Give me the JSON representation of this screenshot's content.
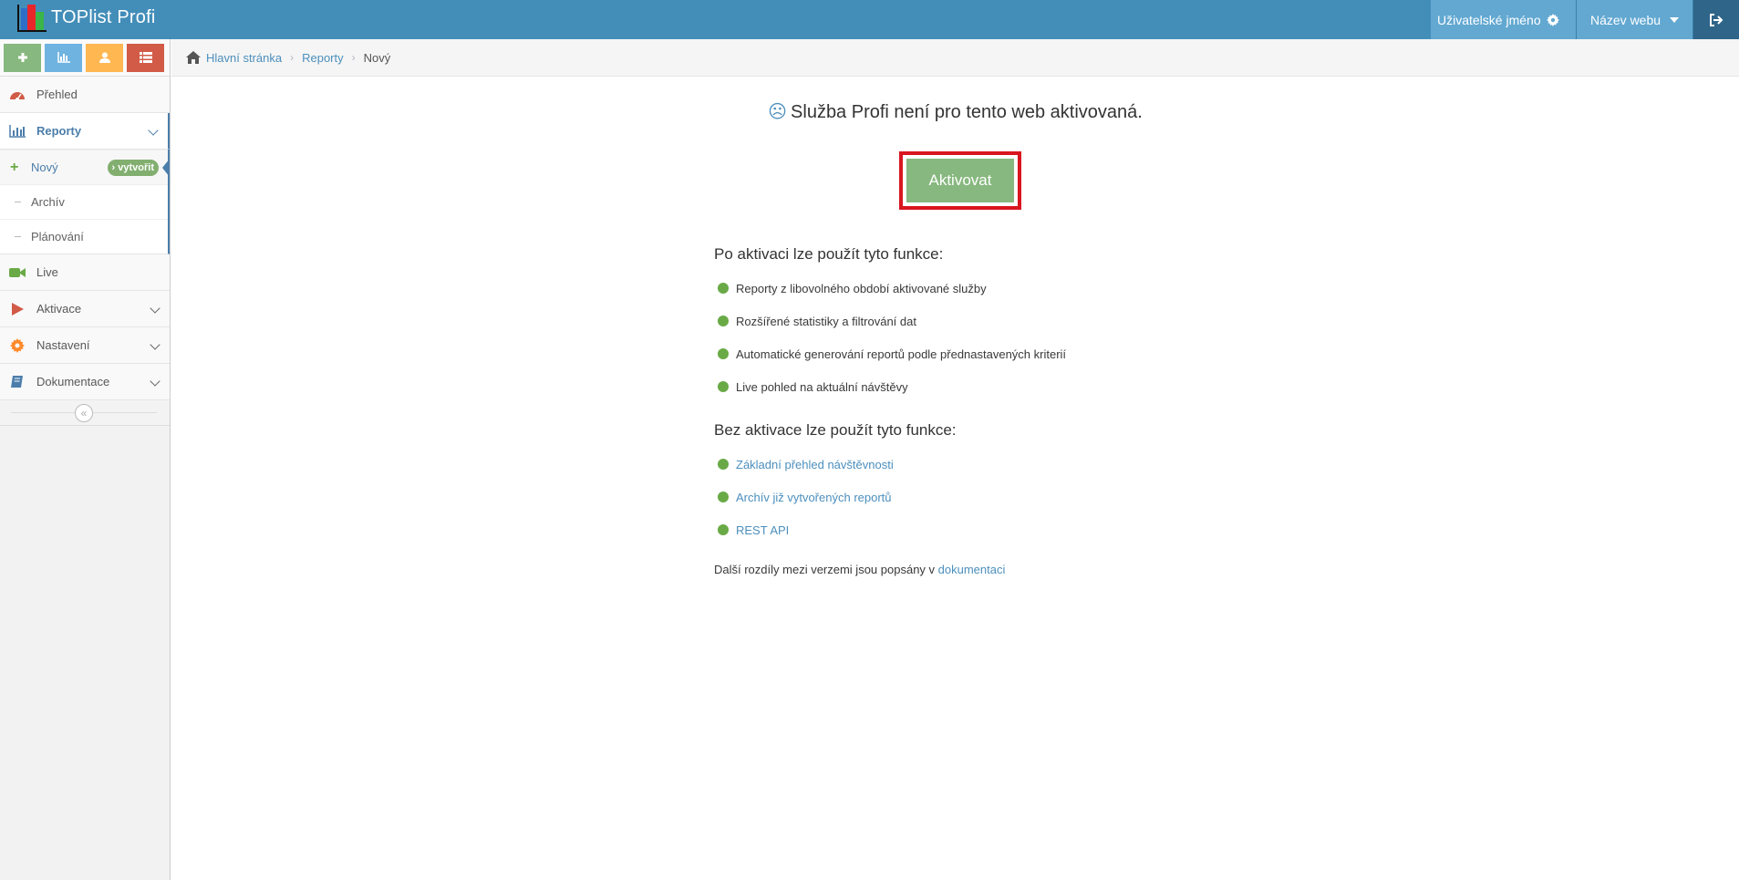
{
  "app": {
    "brand": "TOPlist Profi",
    "user_label": "Uživatelské jméno",
    "site_label": "Název webu"
  },
  "colors": {
    "navbar": "#438eb9",
    "accent_green": "#87b87f",
    "link": "#4c8fbd",
    "highlight_border": "#d9161f"
  },
  "shortcuts": [
    {
      "icon": "plus-icon",
      "color": "#87b87f"
    },
    {
      "icon": "bar-chart-icon",
      "color": "#6fb3e0"
    },
    {
      "icon": "user-icon",
      "color": "#ffb752"
    },
    {
      "icon": "list-icon",
      "color": "#d15b47"
    }
  ],
  "sidebar": {
    "items": [
      {
        "label": "Přehled",
        "icon": "dashboard-icon"
      },
      {
        "label": "Reporty",
        "icon": "bar-chart-icon",
        "open": true
      },
      {
        "label": "Live",
        "icon": "video-camera-icon"
      },
      {
        "label": "Aktivace",
        "icon": "play-icon"
      },
      {
        "label": "Nastavení",
        "icon": "gear-icon"
      },
      {
        "label": "Dokumentace",
        "icon": "book-icon"
      }
    ],
    "submenu": [
      {
        "label": "Nový",
        "badge": "› vytvořit",
        "active": true
      },
      {
        "label": "Archív"
      },
      {
        "label": "Plánování"
      }
    ],
    "collapse_icon": "«"
  },
  "breadcrumb": {
    "home": "Hlavní stránka",
    "reports": "Reporty",
    "current": "Nový"
  },
  "main": {
    "sad_icon": "☹",
    "headline": "Služba Profi není pro tento web aktivovaná.",
    "activate_label": "Aktivovat",
    "with_activation_heading": "Po aktivaci lze použít tyto funkce:",
    "with_activation": [
      "Reporty z libovolného období aktivované služby",
      "Rozšířené statistiky a filtrování dat",
      "Automatické generování reportů podle přednastavených kriterií",
      "Live pohled na aktuální návštěvy"
    ],
    "without_activation_heading": "Bez aktivace lze použít tyto funkce:",
    "without_activation": [
      "Základní přehled návštěvnosti",
      "Archív již vytvořených reportů",
      "REST API"
    ],
    "note_text": "Další rozdíly mezi verzemi jsou popsány v ",
    "note_link": "dokumentaci"
  }
}
